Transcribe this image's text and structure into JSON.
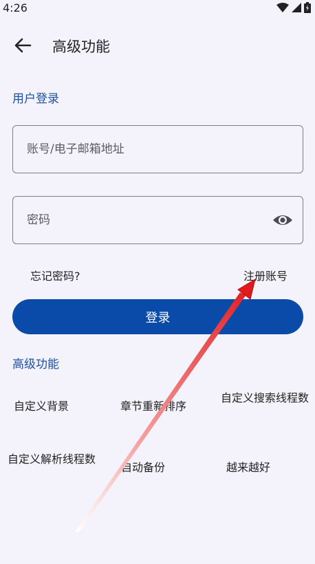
{
  "status_bar": {
    "time": "4:26",
    "icons": [
      "wifi-icon",
      "signal-icon",
      "battery-icon"
    ]
  },
  "header": {
    "back_icon": "arrow-left-icon",
    "title": "高级功能"
  },
  "login": {
    "section_title": "用户登录",
    "account_placeholder": "账号/电子邮箱地址",
    "password_placeholder": "密码",
    "password_toggle_icon": "eye-icon",
    "forgot_password": "忘记密码?",
    "register": "注册账号",
    "login_button": "登录"
  },
  "features": {
    "section_title": "高级功能",
    "items": [
      {
        "label": "自定义背景"
      },
      {
        "label": "章节重新排序"
      },
      {
        "label": "自定义搜索线程数"
      },
      {
        "label": "自定义解析线程数"
      },
      {
        "label": "自动备份"
      },
      {
        "label": "越来越好"
      }
    ]
  },
  "colors": {
    "background": "#f4f3fb",
    "accent": "#1e4fa3",
    "primary_button": "#0a4aa8",
    "annotation_arrow": "#e0191e"
  }
}
